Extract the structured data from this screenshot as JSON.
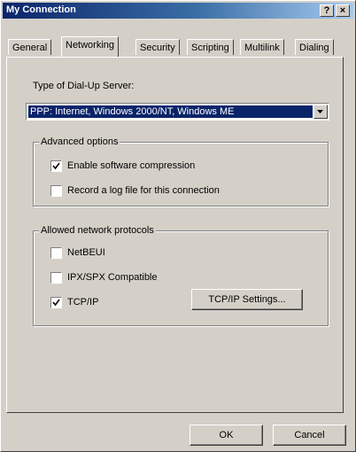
{
  "window": {
    "title": "My Connection",
    "help_button": "?",
    "close_button": "×"
  },
  "tabs": [
    {
      "label": "General",
      "active": false
    },
    {
      "label": "Networking",
      "active": true
    },
    {
      "label": "Security",
      "active": false
    },
    {
      "label": "Scripting",
      "active": false
    },
    {
      "label": "Multilink",
      "active": false
    },
    {
      "label": "Dialing",
      "active": false
    }
  ],
  "server_type": {
    "label": "Type of Dial-Up Server:",
    "selected": "PPP: Internet, Windows 2000/NT, Windows ME"
  },
  "advanced_options": {
    "title": "Advanced options",
    "items": [
      {
        "label": "Enable software compression",
        "checked": true
      },
      {
        "label": "Record a log file for this connection",
        "checked": false
      }
    ]
  },
  "protocols": {
    "title": "Allowed network protocols",
    "items": [
      {
        "label": "NetBEUI",
        "checked": false
      },
      {
        "label": "IPX/SPX Compatible",
        "checked": false
      },
      {
        "label": "TCP/IP",
        "checked": true
      }
    ],
    "settings_button": "TCP/IP Settings..."
  },
  "footer": {
    "ok_label": "OK",
    "cancel_label": "Cancel"
  }
}
